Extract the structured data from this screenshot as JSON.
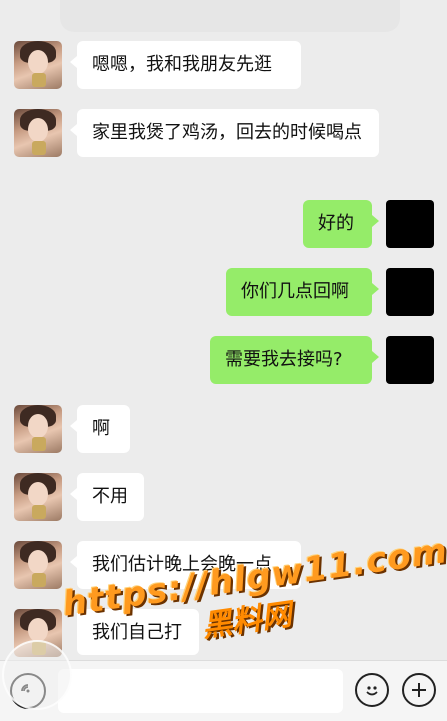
{
  "messages": [
    {
      "side": "in",
      "text": "嗯嗯，我和我朋友先逛"
    },
    {
      "side": "in",
      "text": "家里我煲了鸡汤，回去的时候喝点"
    },
    {
      "side": "out",
      "text": "好的"
    },
    {
      "side": "out",
      "text": "你们几点回啊"
    },
    {
      "side": "out",
      "text": "需要我去接吗?"
    },
    {
      "side": "in",
      "text": "啊"
    },
    {
      "side": "in",
      "text": "不用"
    },
    {
      "side": "in",
      "text": "我们估计晚上会晚一点"
    },
    {
      "side": "in",
      "text": "我们自己打"
    }
  ],
  "input_bar": {
    "voice_icon": "voice-icon",
    "emoji_icon": "emoji-icon",
    "plus_icon": "plus-icon",
    "text_value": ""
  },
  "watermark": {
    "url": "https://hlgw11.com",
    "name": "黑料网"
  },
  "colors": {
    "background": "#ececec",
    "incoming_bubble": "#ffffff",
    "outgoing_bubble": "#95ec69",
    "watermark": "#ff9a1f"
  }
}
